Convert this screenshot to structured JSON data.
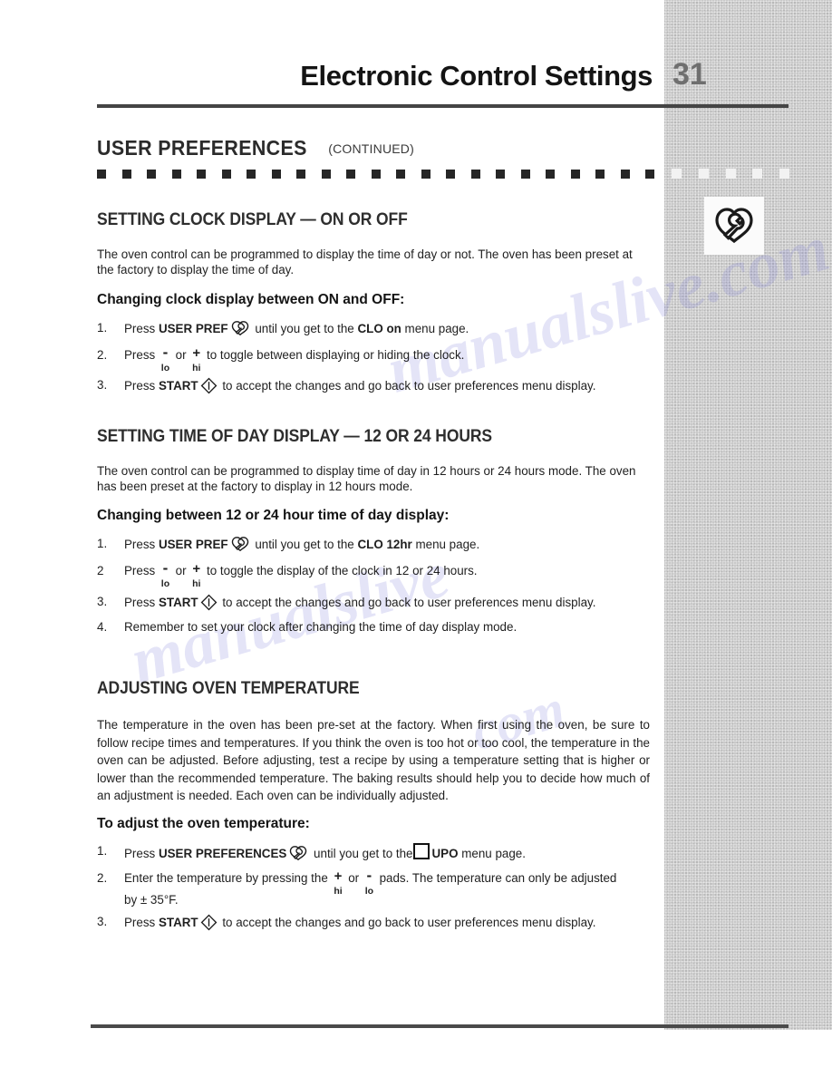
{
  "header": {
    "title": "Electronic Control Settings",
    "page_number": "31"
  },
  "band": {
    "title": "USER PREFERENCES",
    "continued": "(CONTINUED)"
  },
  "icons": {
    "user_preferences": "user-preferences-wrench-icon",
    "start": "start-diamond-icon",
    "square": "square-outline-icon"
  },
  "sections": [
    {
      "heading": "SETTING CLOCK DISPLAY — ON OR OFF",
      "paragraph": "The oven control can be programmed to display the time of day or not.  The oven has been preset at the factory to display the time of day.",
      "subheading": "Changing clock display between ON and OFF:",
      "steps": [
        {
          "num": "1.",
          "pre": "Press ",
          "bold1": "USER PREF",
          "mid": " until you get to the ",
          "bold2": "CLO on",
          "post": " menu page."
        },
        {
          "num": "2.",
          "pre": "Press ",
          "post": " to toggle between displaying or hiding the clock."
        },
        {
          "num": "3.",
          "pre": "Press ",
          "bold1": "START",
          "post": " to accept the changes and go back to user preferences menu display."
        }
      ]
    },
    {
      "heading": "SETTING TIME OF DAY DISPLAY — 12 OR 24 HOURS",
      "paragraph": "The oven control can be programmed to display time of day in 12 hours or 24 hours mode. The oven has been preset at the factory to display in 12 hours mode.",
      "subheading": "Changing between 12 or 24 hour time of day display:",
      "steps": [
        {
          "num": "1.",
          "pre": "Press ",
          "bold1": "USER PREF",
          "mid": " until you get to the ",
          "bold2": "CLO 12hr",
          "post": " menu page."
        },
        {
          "num": "2",
          "pre": "Press ",
          "post": " to toggle the display of the clock in 12 or 24 hours."
        },
        {
          "num": "3.",
          "pre": "Press ",
          "bold1": "START",
          "post": " to accept the changes and go back to user preferences menu display."
        },
        {
          "num": "4.",
          "pre": "Remember to set your clock after changing the time of day display mode."
        }
      ]
    },
    {
      "heading": "ADJUSTING OVEN TEMPERATURE",
      "paragraph": "The temperature in the oven has been pre-set at the factory. When first using the oven, be sure to follow recipe times and temperatures. If you think the oven is too hot or too cool, the temperature in the oven can be adjusted. Before adjusting, test a recipe by using a temperature setting that is higher or lower than the recommended temperature. The baking results should help you to decide how much of an adjustment is needed. Each oven can be individually adjusted.",
      "subheading": "To adjust the oven temperature:",
      "steps": [
        {
          "num": "1.",
          "pre": "Press ",
          "bold1": "USER PREFERENCES",
          "mid": " until you get to the",
          "bold2": "UPO",
          "post": " menu page."
        },
        {
          "num": "2.",
          "pre": "Enter the temperature by pressing the ",
          "mid": " or ",
          "post": " pads. The temperature can only be adjusted by ± 35°F."
        },
        {
          "num": "3.",
          "pre": "Press ",
          "bold1": "START",
          "post": " to accept the changes and go back to user preferences menu display."
        }
      ]
    }
  ],
  "pads": {
    "minus_sign": "-",
    "minus_label": "lo",
    "plus_sign": "+",
    "plus_label": "hi",
    "or": " or "
  },
  "watermark": {
    "line1": "manualslive.com",
    "line2": "manualslive",
    "line3": "com"
  },
  "colors": {
    "sidebar": "#c9c9c9",
    "rule": "#444444",
    "page_number": "#6f6f6f",
    "watermark": "#7878d7"
  }
}
